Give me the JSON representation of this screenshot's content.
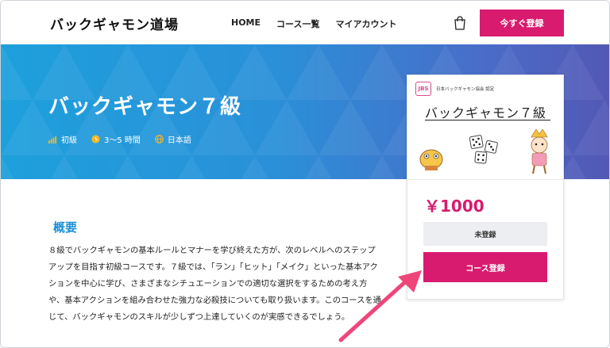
{
  "header": {
    "logo": "バックギャモン道場",
    "nav": [
      "HOME",
      "コース一覧",
      "マイアカウント"
    ],
    "cart_icon": "shopping-bag-icon",
    "signup_label": "今すぐ登録"
  },
  "hero": {
    "title": "バックギャモン７級",
    "meta": [
      {
        "icon": "level-bars-icon",
        "text": "初級"
      },
      {
        "icon": "clock-icon",
        "text": "3〜5 時間"
      },
      {
        "icon": "globe-icon",
        "text": "日本語"
      }
    ]
  },
  "card": {
    "thumb_org": "日本バックギャモン協会 認定",
    "thumb_logo": "JBS",
    "thumb_title": "バックギャモン７級",
    "price": "￥1000",
    "status": "未登録",
    "enroll_label": "コース登録"
  },
  "overview": {
    "title": "概要",
    "body": "８級でバックギャモンの基本ルールとマナーを学び終えた方が、次のレベルへのステップアップを目指す初級コースです。７級では、「ラン」「ヒット」「メイク」といった基本アクションを中心に学び、さまざまなシチュエーションでの適切な選択をするための考え方や、基本アクションを組み合わせた強力な必殺技についても取り扱います。このコースを通じて、バックギャモンのスキルが少しずつ上達していくのが実感できるでしょう。"
  },
  "colors": {
    "accent": "#d81b6e",
    "hero_start": "#1ea0dc",
    "hero_end": "#5358b5",
    "overview_title": "#1a8fd6",
    "arrow": "#f0457a"
  }
}
